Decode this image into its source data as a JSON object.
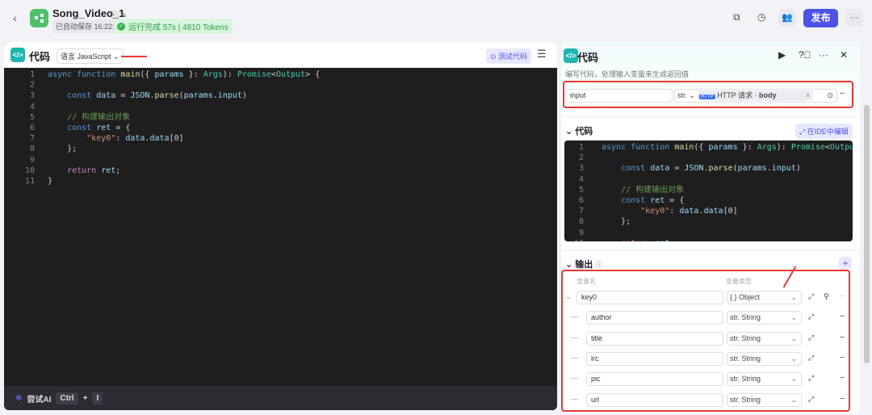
{
  "topbar": {
    "back_icon": "chevron-left-icon",
    "app_name": "Song_Video_1",
    "autosave": "已自动保存 16:22:54",
    "run_status": "运行完成 57s | 4810 Tokens",
    "publish": "发布",
    "more": "···",
    "colors": {
      "accent": "#4d53e8",
      "success": "#34b556"
    }
  },
  "left_panel": {
    "title": "代码",
    "language": "语言 JavaScript",
    "test_code": "测试代码",
    "ai_label": "尝试AI",
    "shortcut_ctrl": "Ctrl",
    "shortcut_plus": "+",
    "shortcut_key": "I"
  },
  "code_lines": [
    [
      [
        "async ",
        "kw"
      ],
      [
        "function ",
        "kw"
      ],
      [
        "main",
        "fn"
      ],
      [
        "({ ",
        "pl"
      ],
      [
        "params",
        "va"
      ],
      [
        " }: ",
        "pl"
      ],
      [
        "Args",
        "ty"
      ],
      [
        "): ",
        "pl"
      ],
      [
        "Promise",
        "ty"
      ],
      [
        "<",
        "pl"
      ],
      [
        "Output",
        "ty"
      ],
      [
        "> {",
        "pl"
      ]
    ],
    [],
    [
      [
        "    const ",
        "kw"
      ],
      [
        "data",
        "va"
      ],
      [
        " = ",
        "pl"
      ],
      [
        "JSON",
        "va"
      ],
      [
        ".",
        "pl"
      ],
      [
        "parse",
        "fn"
      ],
      [
        "(",
        "pl"
      ],
      [
        "params",
        "va"
      ],
      [
        ".",
        "pl"
      ],
      [
        "input",
        "va"
      ],
      [
        ")",
        "pl"
      ]
    ],
    [],
    [
      [
        "    // 构建输出对象",
        "cm"
      ]
    ],
    [
      [
        "    const ",
        "kw"
      ],
      [
        "ret",
        "va"
      ],
      [
        " = {",
        "pl"
      ]
    ],
    [
      [
        "        \"key0\"",
        "st"
      ],
      [
        ": ",
        "pl"
      ],
      [
        "data",
        "va"
      ],
      [
        ".",
        "pl"
      ],
      [
        "data",
        "va"
      ],
      [
        "[0]",
        "pl"
      ]
    ],
    [
      [
        "    };",
        "pl"
      ]
    ],
    [],
    [
      [
        "    return ",
        "rt"
      ],
      [
        "ret",
        "va"
      ],
      [
        ";",
        "pl"
      ]
    ],
    [
      [
        "}",
        "pl"
      ]
    ]
  ],
  "right_panel": {
    "title": "代码",
    "description": "编写代码，处理输入变量来生成返回值",
    "input": {
      "name": "input",
      "type": "str.",
      "source_label": "HTTP 请求",
      "source_field": "body",
      "clear": "×"
    },
    "code_section": "代码",
    "edit_in_ide": "在IDE中编辑",
    "output_section": "输出",
    "col_name": "变量名",
    "col_type": "变量类型",
    "outputs": [
      {
        "name": "key0",
        "type": "{ } Object"
      },
      {
        "name": "author",
        "type": "str. String"
      },
      {
        "name": "title",
        "type": "str. String"
      },
      {
        "name": "lrc",
        "type": "str. String"
      },
      {
        "name": "pic",
        "type": "str. String"
      },
      {
        "name": "url",
        "type": "str. String"
      }
    ]
  }
}
